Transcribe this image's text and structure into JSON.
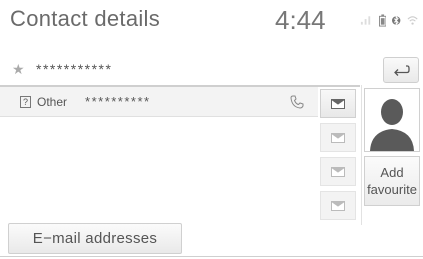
{
  "header": {
    "title": "Contact details",
    "clock": "4:44"
  },
  "status_icons": [
    "signal-icon",
    "battery-icon",
    "bluetooth-icon",
    "wifi-icon"
  ],
  "contact": {
    "name_masked": "***********",
    "favourite_icon": "star-icon"
  },
  "numbers": [
    {
      "type_icon_text": "?",
      "type_label": "Other",
      "value_masked": "**********"
    }
  ],
  "buttons": {
    "back_icon": "back-arrow-icon",
    "add_favourite_line1": "Add",
    "add_favourite_line2": "favourite",
    "email_addresses": "E−mail addresses"
  },
  "colors": {
    "text": "#555555",
    "header_text": "#6a6a6a",
    "row_highlight": "#f3f3f3",
    "border": "#d0d0d0"
  }
}
